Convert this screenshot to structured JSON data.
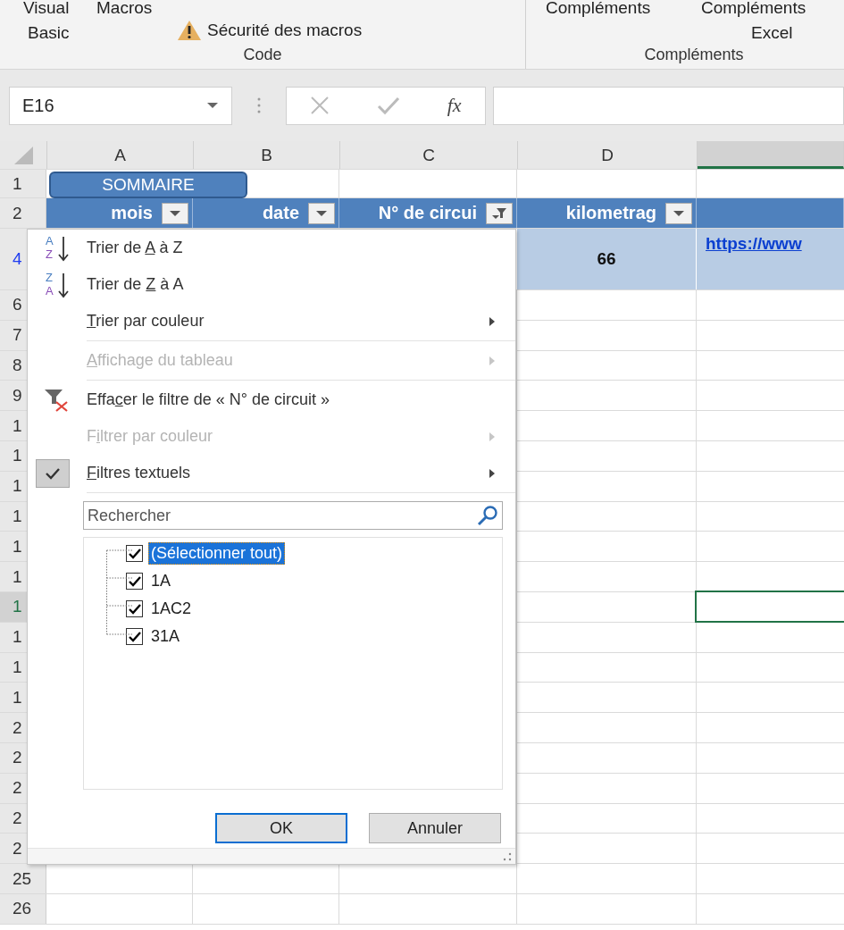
{
  "ribbon": {
    "groups": [
      {
        "label": "Code",
        "items": [
          {
            "kind": "cut-label",
            "text": "Visual"
          },
          {
            "kind": "cut-label",
            "text": "Macros"
          },
          {
            "kind": "label",
            "text": "Basic"
          },
          {
            "kind": "warning",
            "text": "Sécurité des macros"
          }
        ]
      },
      {
        "label": "Compléments",
        "items": [
          {
            "kind": "cut-label",
            "text": "Compléments"
          },
          {
            "kind": "cut-label",
            "text": "Compléments"
          },
          {
            "kind": "label",
            "text": "Excel"
          }
        ]
      }
    ]
  },
  "formula_bar": {
    "name_box": "E16",
    "function_label": "fx"
  },
  "sheet": {
    "columns": [
      {
        "letter": "A",
        "selected": false
      },
      {
        "letter": "B",
        "selected": false
      },
      {
        "letter": "C",
        "selected": false
      },
      {
        "letter": "D",
        "selected": false
      },
      {
        "selected": true
      }
    ],
    "rows": [
      {
        "header": "1",
        "kind": "title",
        "selected": false,
        "filtered": false,
        "button": "SOMMAIRE"
      },
      {
        "header": "2",
        "kind": "table-header",
        "selected": false,
        "filtered": false,
        "cells": [
          {
            "text": "mois",
            "filter_applied": false
          },
          {
            "text": "date",
            "filter_applied": false
          },
          {
            "text": "N° de circui",
            "filter_applied": true
          },
          {
            "text": "kilometrag",
            "filter_applied": false
          }
        ]
      },
      {
        "header": "4",
        "kind": "data",
        "selected": false,
        "filtered": true,
        "cells": [
          {
            "kind": "empty"
          },
          {
            "kind": "empty"
          },
          {
            "kind": "empty"
          },
          {
            "kind": "number",
            "text": "66"
          },
          {
            "kind": "link",
            "text": "https://www"
          }
        ]
      },
      {
        "header": "6",
        "kind": "plain",
        "selected": false,
        "filtered": false
      },
      {
        "header": "7",
        "kind": "plain",
        "selected": false,
        "filtered": false
      },
      {
        "header": "8",
        "kind": "plain",
        "selected": false,
        "filtered": false
      },
      {
        "header": "9",
        "kind": "plain",
        "selected": false,
        "filtered": false
      },
      {
        "header": "1",
        "kind": "plain",
        "selected": false,
        "filtered": false
      },
      {
        "header": "1",
        "kind": "plain",
        "selected": false,
        "filtered": false
      },
      {
        "header": "1",
        "kind": "plain",
        "selected": false,
        "filtered": false
      },
      {
        "header": "1",
        "kind": "plain",
        "selected": false,
        "filtered": false
      },
      {
        "header": "1",
        "kind": "plain",
        "selected": false,
        "filtered": false
      },
      {
        "header": "1",
        "kind": "plain",
        "selected": false,
        "filtered": false
      },
      {
        "header": "1",
        "kind": "plain",
        "selected": true,
        "filtered": false,
        "cells": [
          {
            "kind": "empty"
          },
          {
            "kind": "empty"
          },
          {
            "kind": "empty"
          },
          {
            "kind": "empty"
          },
          {
            "kind": "active"
          }
        ]
      },
      {
        "header": "1",
        "kind": "plain",
        "selected": false,
        "filtered": false
      },
      {
        "header": "1",
        "kind": "plain",
        "selected": false,
        "filtered": false
      },
      {
        "header": "1",
        "kind": "plain",
        "selected": false,
        "filtered": false
      },
      {
        "header": "2",
        "kind": "plain",
        "selected": false,
        "filtered": false
      },
      {
        "header": "2",
        "kind": "plain",
        "selected": false,
        "filtered": false
      },
      {
        "header": "2",
        "kind": "plain",
        "selected": false,
        "filtered": false
      },
      {
        "header": "2",
        "kind": "plain",
        "selected": false,
        "filtered": false
      },
      {
        "header": "2",
        "kind": "plain",
        "selected": false,
        "filtered": false
      },
      {
        "header": "25",
        "kind": "plain",
        "selected": false,
        "filtered": false
      },
      {
        "header": "26",
        "kind": "plain",
        "selected": false,
        "filtered": false
      }
    ]
  },
  "filter_menu": {
    "items": [
      {
        "kind": "item",
        "label": {
          "before": "Trier de ",
          "key": "A",
          "after": " à Z"
        },
        "icon": {
          "kind": "sort",
          "top": "A",
          "bottom": "Z"
        },
        "disabled": false,
        "submenu": false,
        "checked": false
      },
      {
        "kind": "item",
        "label": {
          "before": "Trier de ",
          "key": "Z",
          "after": " à A"
        },
        "icon": {
          "kind": "sort",
          "top": "Z",
          "bottom": "A"
        },
        "disabled": false,
        "submenu": false,
        "checked": false
      },
      {
        "kind": "item",
        "label": {
          "key": "T",
          "after": "rier par couleur"
        },
        "disabled": false,
        "submenu": true,
        "checked": false
      },
      {
        "kind": "separator"
      },
      {
        "kind": "item",
        "label": {
          "key": "A",
          "after": "ffichage du tableau"
        },
        "disabled": true,
        "submenu": true,
        "checked": false
      },
      {
        "kind": "separator"
      },
      {
        "kind": "item",
        "label": {
          "before": "Effa",
          "key": "c",
          "after": "er le filtre de « N° de circuit »"
        },
        "icon": {
          "kind": "clear-filter"
        },
        "disabled": false,
        "submenu": false,
        "checked": false
      },
      {
        "kind": "item",
        "label": {
          "before": "F",
          "key": "i",
          "after": "ltrer par couleur"
        },
        "disabled": true,
        "submenu": true,
        "checked": false
      },
      {
        "kind": "item",
        "label": {
          "key": "F",
          "after": "iltres textuels"
        },
        "disabled": false,
        "submenu": true,
        "checked": true
      },
      {
        "kind": "separator"
      }
    ],
    "search": {
      "placeholder": "Rechercher"
    },
    "values": [
      {
        "label": "(Sélectionner tout)",
        "checked": true,
        "selected": true
      },
      {
        "label": "1A",
        "checked": true,
        "selected": false
      },
      {
        "label": "1AC2",
        "checked": true,
        "selected": false
      },
      {
        "label": "31A",
        "checked": true,
        "selected": false
      }
    ],
    "buttons": [
      {
        "label": "OK",
        "default": true
      },
      {
        "label": "Annuler",
        "default": false
      }
    ]
  }
}
